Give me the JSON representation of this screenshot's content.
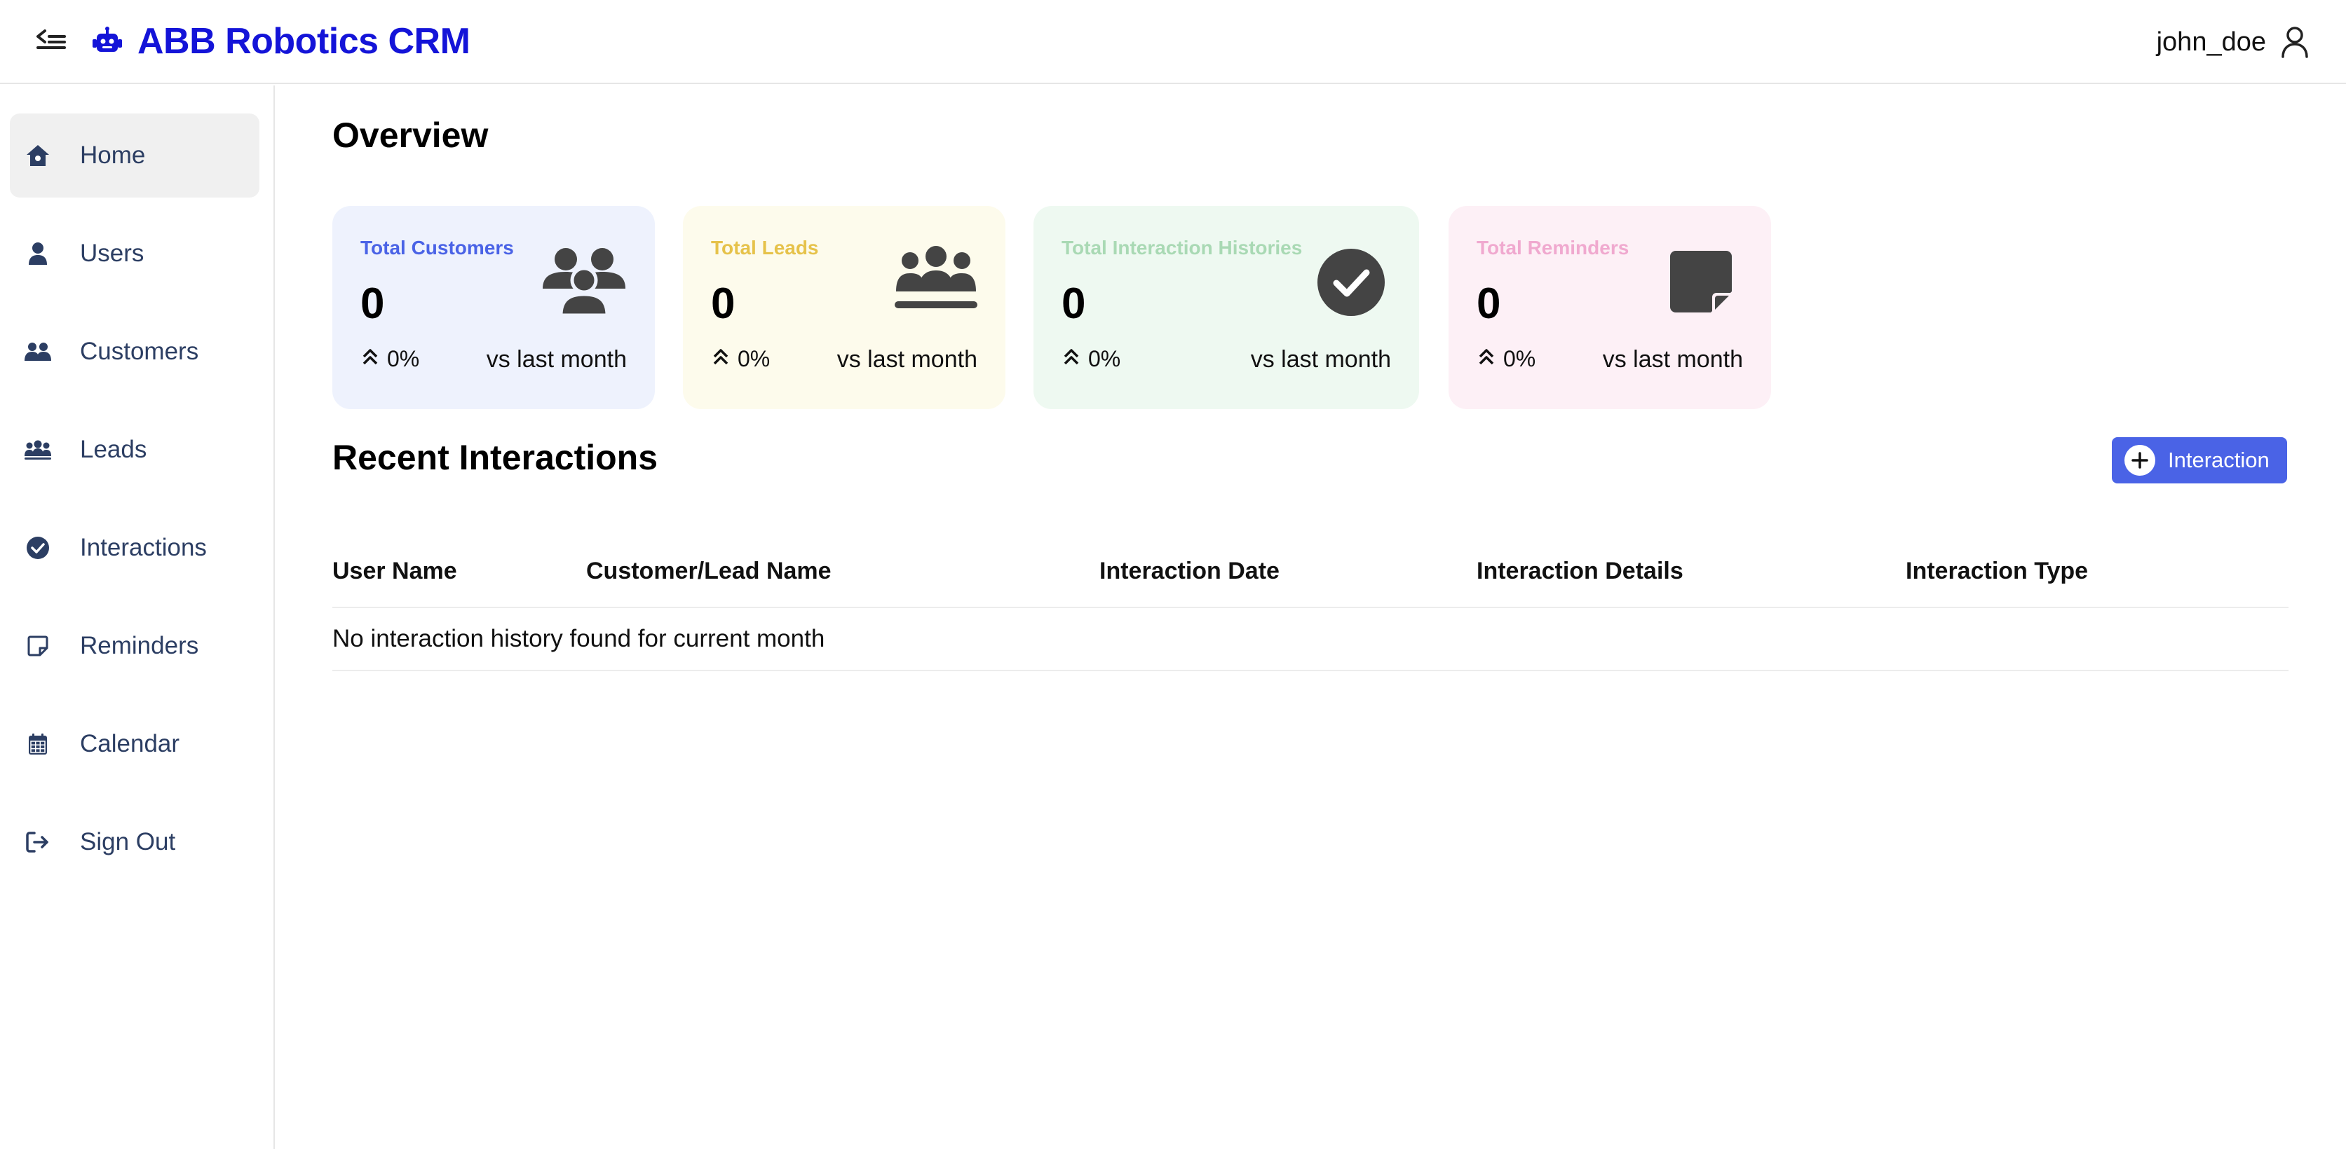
{
  "header": {
    "brand_title": "ABB Robotics CRM",
    "username": "john_doe"
  },
  "sidebar": {
    "items": [
      {
        "label": "Home",
        "icon": "home-icon",
        "active": true
      },
      {
        "label": "Users",
        "icon": "user-icon"
      },
      {
        "label": "Customers",
        "icon": "customers-icon"
      },
      {
        "label": "Leads",
        "icon": "leads-icon"
      },
      {
        "label": "Interactions",
        "icon": "check-circle-icon"
      },
      {
        "label": "Reminders",
        "icon": "sticky-note-icon"
      },
      {
        "label": "Calendar",
        "icon": "calendar-icon"
      },
      {
        "label": "Sign Out",
        "icon": "sign-out-icon"
      }
    ]
  },
  "overview": {
    "title": "Overview",
    "cards": [
      {
        "title": "Total Customers",
        "value": "0",
        "change": "0%",
        "vs": "vs last month",
        "title_color": "#4a63e6",
        "bg_color": "#eef2fd",
        "icon": "users-icon"
      },
      {
        "title": "Total Leads",
        "value": "0",
        "change": "0%",
        "vs": "vs last month",
        "title_color": "#e6c24a",
        "bg_color": "#fdfbec",
        "icon": "people-group-icon"
      },
      {
        "title": "Total Interaction Histories",
        "value": "0",
        "change": "0%",
        "vs": "vs last month",
        "title_color": "#a9d9b4",
        "bg_color": "#eef9f1",
        "icon": "check-circle-icon"
      },
      {
        "title": "Total Reminders",
        "value": "0",
        "change": "0%",
        "vs": "vs last month",
        "title_color": "#f0a9cf",
        "bg_color": "#fdf0f6",
        "icon": "sticky-note-icon"
      }
    ]
  },
  "recent": {
    "title": "Recent Interactions",
    "add_button_label": "Interaction",
    "columns": [
      "User Name",
      "Customer/Lead Name",
      "Interaction Date",
      "Interaction Details",
      "Interaction Type"
    ],
    "empty_message": "No interaction history found for current month"
  },
  "colors": {
    "brand": "#1414d8",
    "nav_text": "#2c3e63",
    "button": "#4a63e6",
    "icon_dark": "#444444"
  }
}
